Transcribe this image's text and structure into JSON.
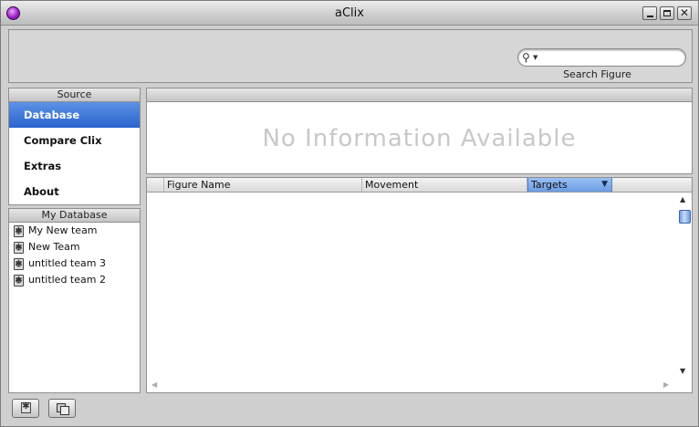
{
  "window": {
    "title": "aClix"
  },
  "toolbar": {
    "search_placeholder": "",
    "search_label": "Search Figure"
  },
  "source": {
    "header": "Source",
    "items": [
      {
        "label": "Database",
        "selected": true
      },
      {
        "label": "Compare Clix",
        "selected": false
      },
      {
        "label": "Extras",
        "selected": false
      },
      {
        "label": "About",
        "selected": false
      }
    ]
  },
  "my_database": {
    "header": "My Database",
    "teams": [
      "My New team",
      "New Team",
      "untitled team 3",
      "untitled team 2"
    ]
  },
  "info": {
    "message": "No Information Available"
  },
  "table": {
    "columns": [
      "",
      "Figure Name",
      "Movement",
      "Targets"
    ],
    "sorted_column": "Targets",
    "sort_direction": "descending",
    "rows": []
  },
  "colors": {
    "selection": "#2a64cd",
    "placeholder_text": "#c8c8c8",
    "sorted_header": "#6b9de6"
  },
  "icons": {
    "app": "app-orb-icon",
    "search": "magnifier-icon",
    "team": "gear-icon",
    "bottom_left": "gear-icon",
    "bottom_right": "duplicate-icon"
  }
}
